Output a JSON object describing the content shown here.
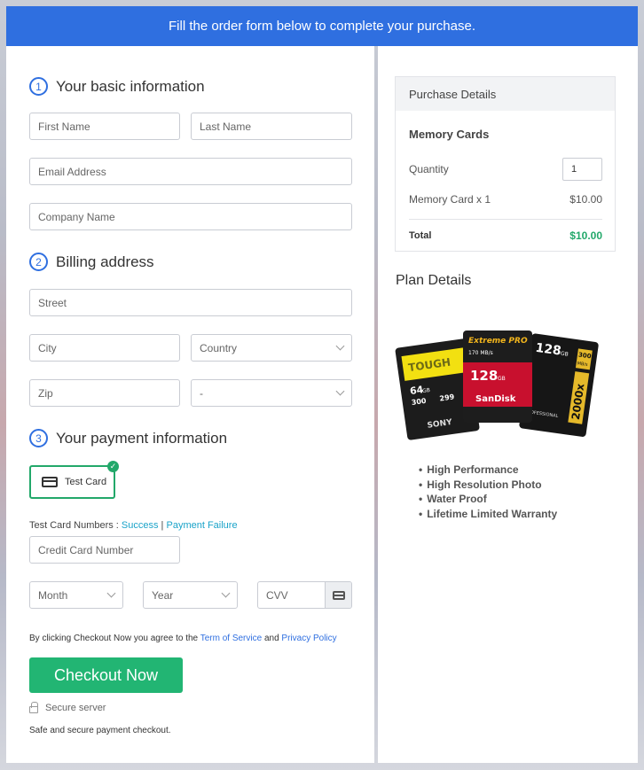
{
  "banner": {
    "text": "Fill the order form below to complete your purchase."
  },
  "sections": {
    "basic": {
      "number": "1",
      "title": "Your basic information"
    },
    "billing": {
      "number": "2",
      "title": "Billing address"
    },
    "payment": {
      "number": "3",
      "title": "Your payment information"
    }
  },
  "fields": {
    "first_name": "First Name",
    "last_name": "Last Name",
    "email": "Email Address",
    "company": "Company Name",
    "street": "Street",
    "city": "City",
    "country": "Country",
    "zip": "Zip",
    "state": "-",
    "card_number": "Credit Card Number",
    "month": "Month",
    "year": "Year",
    "cvv": "CVV"
  },
  "payment": {
    "test_card_label": "Test Card",
    "test_numbers_prefix": "Test Card Numbers : ",
    "success_link": "Success",
    "separator": " | ",
    "failure_link": "Payment Failure"
  },
  "terms": {
    "prefix": "By clicking Checkout Now you agree to the ",
    "terms_link": "Term of Service",
    "and": " and ",
    "privacy_link": "Privacy Policy"
  },
  "checkout": {
    "button": "Checkout Now",
    "secure": "Secure server",
    "safe_note": "Safe and secure payment checkout."
  },
  "purchase": {
    "header": "Purchase Details",
    "product": "Memory Cards",
    "quantity_label": "Quantity",
    "quantity_value": "1",
    "line_item": "Memory Card x 1",
    "line_price": "$10.00",
    "total_label": "Total",
    "total_value": "$10.00"
  },
  "plan": {
    "title": "Plan Details",
    "cards": {
      "left_brand": "TOUGH",
      "left_capacity": "64",
      "left_unit": "GB",
      "left_speed": "300",
      "left_speed2": "299",
      "left_maker": "SONY",
      "middle_brand": "Extreme PRO",
      "middle_speed": "170 MB/s",
      "middle_capacity": "128",
      "middle_unit": "GB",
      "middle_maker": "SanDisk",
      "right_capacity": "128",
      "right_unit": "GB",
      "right_speed": "300",
      "right_speed_unit": "MB/s",
      "right_x": "2000x",
      "right_word": "PROFESSIONAL"
    },
    "features": [
      "High Performance",
      "High Resolution Photo",
      "Water Proof",
      "Lifetime Limited Warranty"
    ]
  },
  "colors": {
    "accent": "#2f6fe0",
    "success": "#22b573",
    "total_green": "#22a86a",
    "link": "#1aa3c9"
  }
}
